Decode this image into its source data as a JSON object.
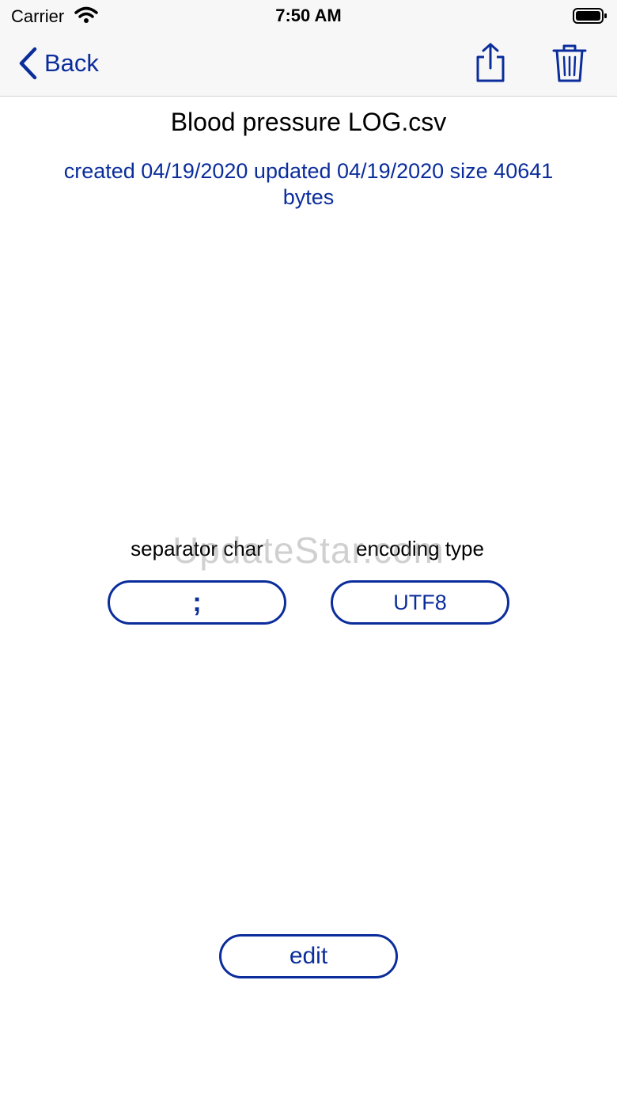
{
  "status_bar": {
    "carrier": "Carrier",
    "time": "7:50 AM"
  },
  "nav": {
    "back_label": "Back",
    "share_icon": "share-icon",
    "trash_icon": "trash-icon"
  },
  "file": {
    "title": "Blood pressure LOG.csv",
    "info": "created 04/19/2020  updated 04/19/2020 size 40641 bytes"
  },
  "settings": {
    "separator_label": "separator char",
    "separator_value": ";",
    "encoding_label": "encoding type",
    "encoding_value": "UTF8"
  },
  "actions": {
    "edit_label": "edit"
  },
  "watermark": "UpdateStar.com",
  "colors": {
    "accent": "#0b2d9c",
    "nav_background": "#f7f7f7"
  }
}
